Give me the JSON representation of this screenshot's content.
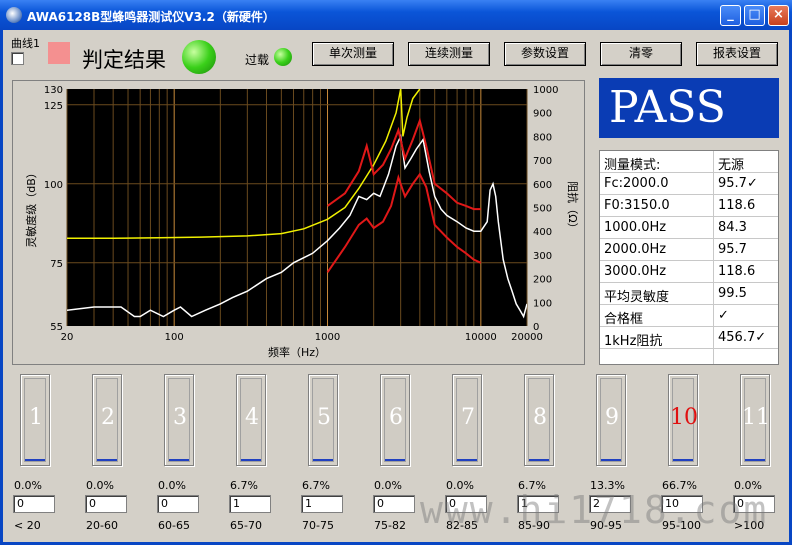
{
  "window": {
    "title": "AWA6128B型蜂鸣器测试仪V3.2（新硬件）",
    "min_label": "_",
    "max_label": "□",
    "close_label": "×"
  },
  "toolbar": {
    "curve_label": "曲线1",
    "verdict_label": "判定结果",
    "overload_label": "过载",
    "buttons": [
      "单次测量",
      "连续测量",
      "参数设置",
      "清零",
      "报表设置"
    ]
  },
  "result": {
    "status": "PASS"
  },
  "measurements": [
    {
      "label": "测量模式:",
      "value": "无源"
    },
    {
      "label": "Fc:2000.0",
      "value": "95.7✓"
    },
    {
      "label": "F0:3150.0",
      "value": "118.6"
    },
    {
      "label": "1000.0Hz",
      "value": "84.3"
    },
    {
      "label": "2000.0Hz",
      "value": "95.7"
    },
    {
      "label": "3000.0Hz",
      "value": "118.6"
    },
    {
      "label": "平均灵敏度",
      "value": "99.5"
    },
    {
      "label": "合格框",
      "value": "✓"
    },
    {
      "label": "1kHz阻抗",
      "value": "456.7✓"
    }
  ],
  "histogram": {
    "bins": [
      {
        "num": "1",
        "pct": "0.0%",
        "count": "0",
        "range": "< 20"
      },
      {
        "num": "2",
        "pct": "0.0%",
        "count": "0",
        "range": "20-60"
      },
      {
        "num": "3",
        "pct": "0.0%",
        "count": "0",
        "range": "60-65"
      },
      {
        "num": "4",
        "pct": "6.7%",
        "count": "1",
        "range": "65-70"
      },
      {
        "num": "5",
        "pct": "6.7%",
        "count": "1",
        "range": "70-75"
      },
      {
        "num": "6",
        "pct": "0.0%",
        "count": "0",
        "range": "75-82"
      },
      {
        "num": "7",
        "pct": "0.0%",
        "count": "0",
        "range": "82-85"
      },
      {
        "num": "8",
        "pct": "6.7%",
        "count": "1",
        "range": "85-90"
      },
      {
        "num": "9",
        "pct": "13.3%",
        "count": "2",
        "range": "90-95"
      },
      {
        "num": "10",
        "pct": "66.7%",
        "count": "10",
        "range": "95-100"
      },
      {
        "num": "11",
        "pct": "0.0%",
        "count": "0",
        "range": ">100"
      }
    ]
  },
  "watermark": "www.hi1718.com",
  "chart_data": {
    "type": "line",
    "xlabel": "频率（Hz）",
    "ylabel": "灵敏度级（dB）",
    "y2label": "阻抗（Ω）",
    "xscale": "log",
    "xlim": [
      20,
      20000
    ],
    "ylim": [
      55,
      130
    ],
    "y2lim": [
      0,
      1000
    ],
    "xticks": [
      "20",
      "100",
      "1000",
      "10000",
      "20000"
    ],
    "xtick_values": [
      20,
      100,
      1000,
      10000,
      20000
    ],
    "yticks": [
      "55",
      "75",
      "100",
      "125",
      "130"
    ],
    "ytick_values": [
      55,
      75,
      100,
      125,
      130
    ],
    "y2ticks": [
      "0",
      "100",
      "200",
      "300",
      "400",
      "500",
      "600",
      "700",
      "800",
      "900",
      "1000"
    ],
    "series": [
      {
        "axis": "y2",
        "color": "#f0f000",
        "x": [
          20,
          40,
          80,
          150,
          300,
          500,
          700,
          1000,
          1300,
          1600,
          2000,
          2400,
          2800,
          3000,
          3100,
          3300,
          3600,
          4000
        ],
        "y": [
          370,
          370,
          372,
          375,
          380,
          390,
          410,
          450,
          500,
          580,
          680,
          780,
          900,
          1000,
          800,
          880,
          960,
          1000
        ]
      },
      {
        "axis": "y1",
        "color": "#ffffff",
        "x": [
          20,
          30,
          45,
          55,
          60,
          70,
          85,
          100,
          110,
          130,
          160,
          200,
          240,
          300,
          400,
          500,
          600,
          800,
          1000,
          1200,
          1400,
          1600,
          1800,
          2000,
          2200,
          2500,
          2800,
          3000,
          3200,
          3500,
          3800,
          4200,
          4600,
          5000,
          5500,
          6000,
          7000,
          8000,
          9000,
          10000,
          11000,
          11500,
          12000,
          12500,
          13000,
          14000,
          15000,
          16000,
          17000,
          18000,
          19000,
          20000
        ],
        "y": [
          60,
          61,
          61,
          58,
          58,
          60,
          58,
          60,
          61,
          58,
          60,
          62,
          64,
          66,
          70,
          72,
          75,
          78,
          82,
          86,
          90,
          96,
          95,
          97,
          96,
          103,
          112,
          115,
          105,
          108,
          111,
          114,
          104,
          96,
          92,
          90,
          88,
          86,
          85,
          85,
          88,
          98,
          100,
          96,
          88,
          76,
          70,
          66,
          62,
          60,
          58,
          62
        ]
      },
      {
        "axis": "y1",
        "color": "#e01818",
        "x": [
          1000,
          1300,
          1600,
          1800,
          2000,
          2300,
          2600,
          2900,
          3200,
          3600,
          4000,
          4400,
          5000,
          6000,
          7000,
          8000,
          9000,
          10000
        ],
        "y": [
          93,
          97,
          104,
          112,
          103,
          106,
          111,
          117,
          108,
          114,
          120,
          112,
          100,
          97,
          94,
          93,
          92,
          92
        ]
      },
      {
        "axis": "y1",
        "color": "#e01818",
        "x": [
          1000,
          1300,
          1600,
          1800,
          2000,
          2300,
          2600,
          2900,
          3200,
          3600,
          4000,
          4400,
          5000,
          6000,
          7000,
          8000,
          9000,
          10000
        ],
        "y": [
          72,
          80,
          87,
          89,
          86,
          88,
          93,
          102,
          96,
          100,
          103,
          99,
          87,
          83,
          80,
          78,
          76,
          75
        ]
      }
    ]
  }
}
